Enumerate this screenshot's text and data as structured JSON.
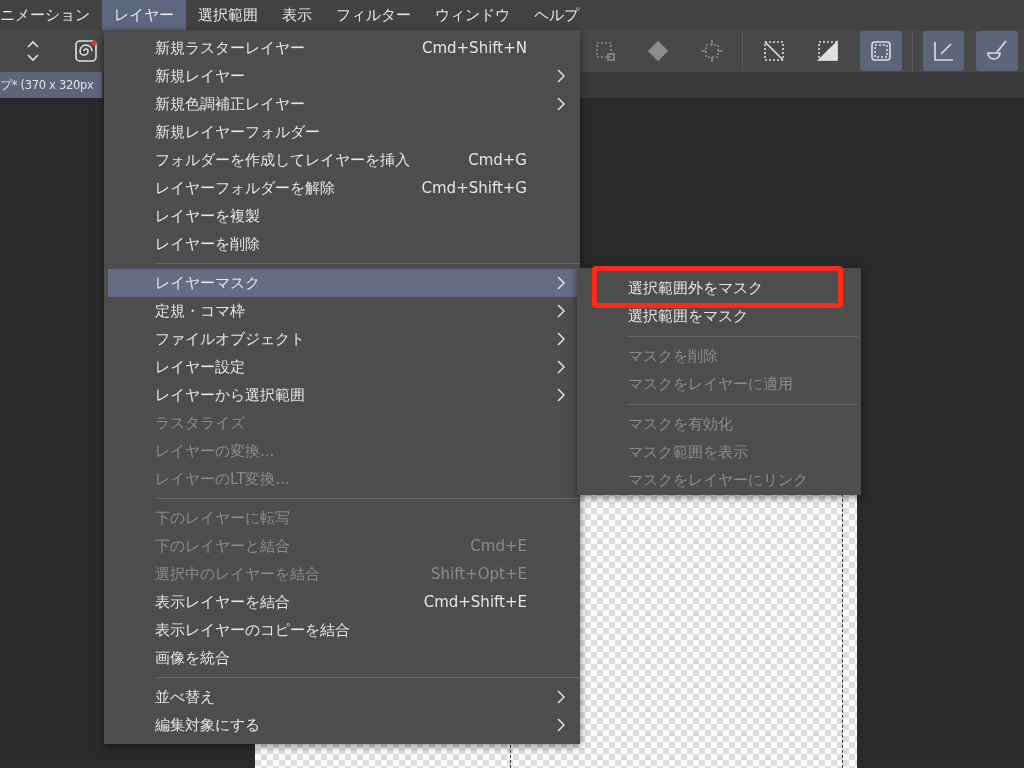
{
  "menubar": [
    {
      "label": "ニメーション",
      "selected": false
    },
    {
      "label": "レイヤー",
      "selected": true
    },
    {
      "label": "選択範囲",
      "selected": false
    },
    {
      "label": "表示",
      "selected": false
    },
    {
      "label": "フィルター",
      "selected": false
    },
    {
      "label": "ウィンドウ",
      "selected": false
    },
    {
      "label": "ヘルプ",
      "selected": false
    }
  ],
  "toolbar": [
    {
      "kind": "updown",
      "selected": false,
      "disabled": false
    },
    {
      "kind": "swirl",
      "selected": false,
      "disabled": false
    },
    {
      "kind": "dotted-square",
      "selected": false,
      "disabled": true
    },
    {
      "kind": "bucket",
      "selected": false,
      "disabled": true
    },
    {
      "kind": "crop",
      "selected": false,
      "disabled": true
    },
    {
      "kind": "divider"
    },
    {
      "kind": "dashed-slash",
      "selected": false,
      "disabled": false
    },
    {
      "kind": "half-square",
      "selected": false,
      "disabled": false
    },
    {
      "kind": "rounded-square",
      "selected": true,
      "disabled": false
    },
    {
      "kind": "divider"
    },
    {
      "kind": "pen",
      "selected": true,
      "disabled": false
    },
    {
      "kind": "brush",
      "selected": true,
      "disabled": false
    }
  ],
  "document_tab": {
    "title": "プ* (370 x 320px",
    "selected": true
  },
  "menu": {
    "items": [
      {
        "kind": "item",
        "label": "新規ラスターレイヤー",
        "shortcut": "Cmd+Shift+N",
        "submenu": false,
        "disabled": false,
        "selected": false
      },
      {
        "kind": "item",
        "label": "新規レイヤー",
        "submenu": true,
        "disabled": false,
        "selected": false
      },
      {
        "kind": "item",
        "label": "新規色調補正レイヤー",
        "submenu": true,
        "disabled": false,
        "selected": false
      },
      {
        "kind": "item",
        "label": "新規レイヤーフォルダー",
        "submenu": false,
        "disabled": false,
        "selected": false
      },
      {
        "kind": "item",
        "label": "フォルダーを作成してレイヤーを挿入",
        "shortcut": "Cmd+G",
        "submenu": false,
        "disabled": false,
        "selected": false
      },
      {
        "kind": "item",
        "label": "レイヤーフォルダーを解除",
        "shortcut": "Cmd+Shift+G",
        "submenu": false,
        "disabled": false,
        "selected": false
      },
      {
        "kind": "item",
        "label": "レイヤーを複製",
        "submenu": false,
        "disabled": false,
        "selected": false
      },
      {
        "kind": "item",
        "label": "レイヤーを削除",
        "submenu": false,
        "disabled": false,
        "selected": false
      },
      {
        "kind": "separator"
      },
      {
        "kind": "item",
        "label": "レイヤーマスク",
        "submenu": true,
        "disabled": false,
        "selected": true
      },
      {
        "kind": "item",
        "label": "定規・コマ枠",
        "submenu": true,
        "disabled": false,
        "selected": false
      },
      {
        "kind": "item",
        "label": "ファイルオブジェクト",
        "submenu": true,
        "disabled": false,
        "selected": false
      },
      {
        "kind": "item",
        "label": "レイヤー設定",
        "submenu": true,
        "disabled": false,
        "selected": false
      },
      {
        "kind": "item",
        "label": "レイヤーから選択範囲",
        "submenu": true,
        "disabled": false,
        "selected": false
      },
      {
        "kind": "item",
        "label": "ラスタライズ",
        "submenu": false,
        "disabled": true,
        "selected": false
      },
      {
        "kind": "item",
        "label": "レイヤーの変換...",
        "submenu": false,
        "disabled": true,
        "selected": false
      },
      {
        "kind": "item",
        "label": "レイヤーのLT変換...",
        "submenu": false,
        "disabled": true,
        "selected": false
      },
      {
        "kind": "separator"
      },
      {
        "kind": "item",
        "label": "下のレイヤーに転写",
        "submenu": false,
        "disabled": true,
        "selected": false
      },
      {
        "kind": "item",
        "label": "下のレイヤーと結合",
        "shortcut": "Cmd+E",
        "submenu": false,
        "disabled": true,
        "selected": false
      },
      {
        "kind": "item",
        "label": "選択中のレイヤーを結合",
        "shortcut": "Shift+Opt+E",
        "submenu": false,
        "disabled": true,
        "selected": false
      },
      {
        "kind": "item",
        "label": "表示レイヤーを結合",
        "shortcut": "Cmd+Shift+E",
        "submenu": false,
        "disabled": false,
        "selected": false
      },
      {
        "kind": "item",
        "label": "表示レイヤーのコピーを結合",
        "submenu": false,
        "disabled": false,
        "selected": false
      },
      {
        "kind": "item",
        "label": "画像を統合",
        "submenu": false,
        "disabled": false,
        "selected": false
      },
      {
        "kind": "separator"
      },
      {
        "kind": "item",
        "label": "並べ替え",
        "submenu": true,
        "disabled": false,
        "selected": false
      },
      {
        "kind": "item",
        "label": "編集対象にする",
        "submenu": true,
        "disabled": false,
        "selected": false
      }
    ]
  },
  "submenu": {
    "items": [
      {
        "kind": "item",
        "label": "選択範囲外をマスク",
        "disabled": false,
        "callout": true
      },
      {
        "kind": "item",
        "label": "選択範囲をマスク",
        "disabled": false,
        "callout": false
      },
      {
        "kind": "separator"
      },
      {
        "kind": "item",
        "label": "マスクを削除",
        "disabled": true,
        "callout": false
      },
      {
        "kind": "item",
        "label": "マスクをレイヤーに適用",
        "disabled": true,
        "callout": false
      },
      {
        "kind": "separator"
      },
      {
        "kind": "item",
        "label": "マスクを有効化",
        "disabled": true,
        "callout": false
      },
      {
        "kind": "item",
        "label": "マスク範囲を表示",
        "disabled": true,
        "callout": false
      },
      {
        "kind": "item",
        "label": "マスクをレイヤーにリンク",
        "disabled": true,
        "callout": false
      }
    ]
  }
}
